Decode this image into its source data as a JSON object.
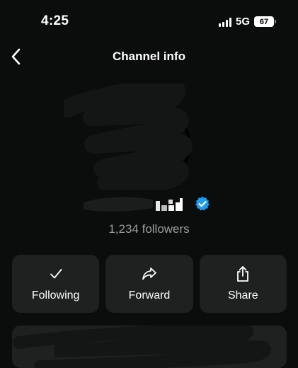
{
  "status_bar": {
    "time": "4:25",
    "network": "5G",
    "battery": "67"
  },
  "nav": {
    "title": "Channel info"
  },
  "channel": {
    "followers": "1,234 followers"
  },
  "actions": [
    {
      "label": "Following",
      "icon": "checkmark-icon"
    },
    {
      "label": "Forward",
      "icon": "forward-arrow-icon"
    },
    {
      "label": "Share",
      "icon": "share-icon"
    }
  ],
  "colors": {
    "background": "#0b0c0c",
    "card": "#1f2121",
    "verified": "#1d9bf0",
    "muted_text": "#9a9d9e"
  }
}
